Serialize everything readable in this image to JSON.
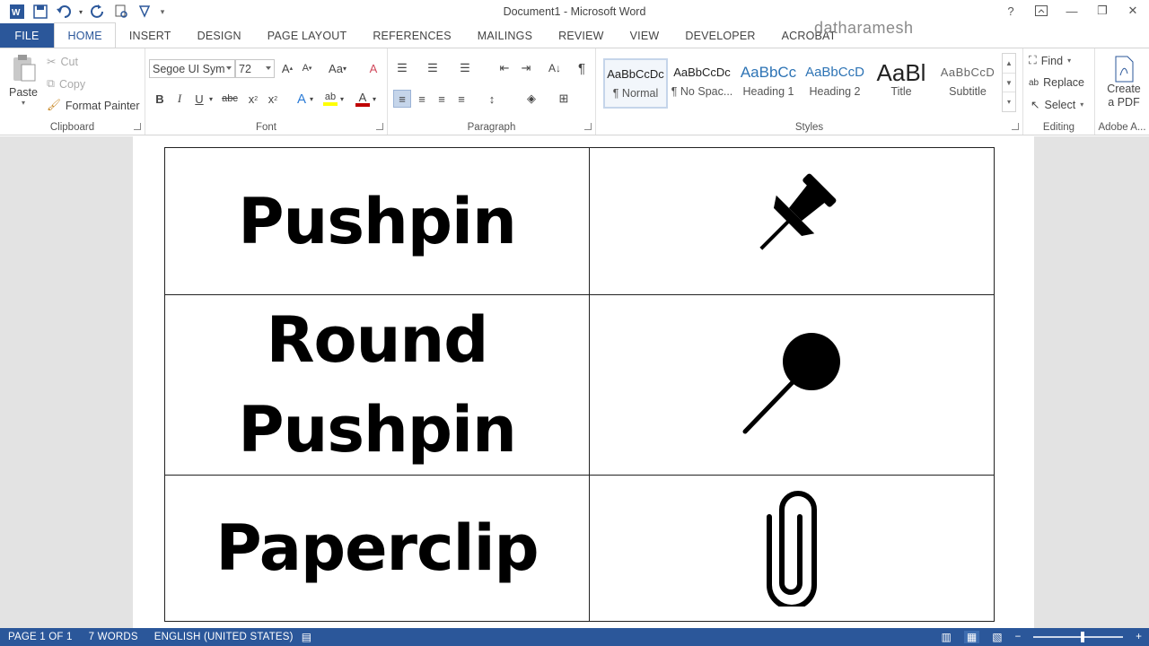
{
  "window": {
    "title": "Document1 - Microsoft Word"
  },
  "watermark": "datharamesh",
  "window_controls": {
    "help": "?",
    "minimize": "—",
    "restore": "❐",
    "close": "✕"
  },
  "tabs": [
    "FILE",
    "HOME",
    "INSERT",
    "DESIGN",
    "PAGE LAYOUT",
    "REFERENCES",
    "MAILINGS",
    "REVIEW",
    "VIEW",
    "DEVELOPER",
    "ACROBAT"
  ],
  "clipboard": {
    "paste": "Paste",
    "cut": "Cut",
    "copy": "Copy",
    "format_painter": "Format Painter",
    "label": "Clipboard"
  },
  "font": {
    "family": "Segoe UI Symt",
    "size": "72",
    "case": "Aa",
    "label": "Font"
  },
  "paragraph": {
    "label": "Paragraph"
  },
  "styles": {
    "label": "Styles",
    "items": [
      {
        "sample": "AaBbCcDc",
        "name": "¶ Normal"
      },
      {
        "sample": "AaBbCcDc",
        "name": "¶ No Spac..."
      },
      {
        "sample": "AaBbCc",
        "name": "Heading 1"
      },
      {
        "sample": "AaBbCcD",
        "name": "Heading 2"
      },
      {
        "sample": "AaBl",
        "name": "Title"
      },
      {
        "sample": "AaBbCcD",
        "name": "Subtitle"
      }
    ]
  },
  "editing": {
    "find": "Find",
    "replace": "Replace",
    "select": "Select",
    "label": "Editing"
  },
  "adobe": {
    "create_line1": "Create",
    "create_line2": "a PDF",
    "label": "Adobe A..."
  },
  "document": {
    "rows": [
      {
        "label_lines": [
          "Pushpin"
        ],
        "icon": "pushpin-icon"
      },
      {
        "label_lines": [
          "Round",
          "Pushpin"
        ],
        "icon": "round-pushpin-icon"
      },
      {
        "label_lines": [
          "Paperclip"
        ],
        "icon": "paperclip-icon"
      }
    ]
  },
  "status": {
    "page": "PAGE 1 OF 1",
    "words": "7 WORDS",
    "language": "ENGLISH (UNITED STATES)",
    "zoom_minus": "−",
    "zoom_plus": "+"
  },
  "colors": {
    "accent": "#2b579a",
    "highlight": "#ffff00",
    "font_color": "#c00000"
  }
}
